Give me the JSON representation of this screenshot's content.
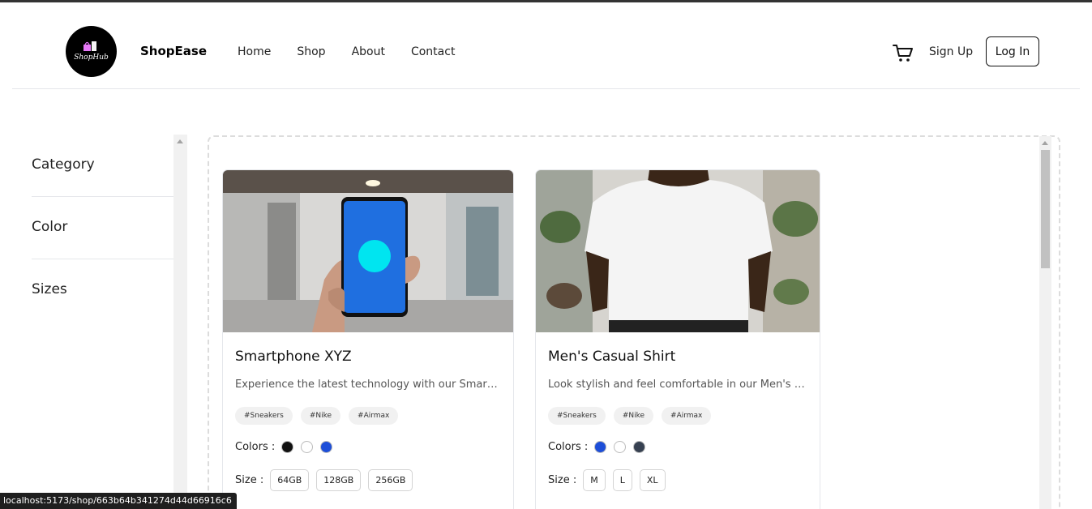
{
  "header": {
    "logo_text": "ShopHub",
    "brand": "ShopEase",
    "nav": [
      "Home",
      "Shop",
      "About",
      "Contact"
    ],
    "cart_icon": "cart-icon",
    "signup": "Sign Up",
    "login": "Log In"
  },
  "sidebar": {
    "filters": [
      "Category",
      "Color",
      "Sizes"
    ]
  },
  "products": [
    {
      "title": "Smartphone XYZ",
      "description": "Experience the latest technology with our Smartphone XYZ",
      "tags": [
        "#Sneakers",
        "#Nike",
        "#Airmax"
      ],
      "colors_label": "Colors :",
      "colors": [
        "#111111",
        "#ffffff",
        "#1d4ed8"
      ],
      "size_label": "Size :",
      "sizes": [
        "64GB",
        "128GB",
        "256GB"
      ]
    },
    {
      "title": "Men's Casual Shirt",
      "description": "Look stylish and feel comfortable in our Men's Casual Shirt",
      "tags": [
        "#Sneakers",
        "#Nike",
        "#Airmax"
      ],
      "colors_label": "Colors :",
      "colors": [
        "#1d4ed8",
        "#ffffff",
        "#374151"
      ],
      "size_label": "Size :",
      "sizes": [
        "M",
        "L",
        "XL"
      ]
    }
  ],
  "status_url": "localhost:5173/shop/663b64b341274d44d66916c6"
}
